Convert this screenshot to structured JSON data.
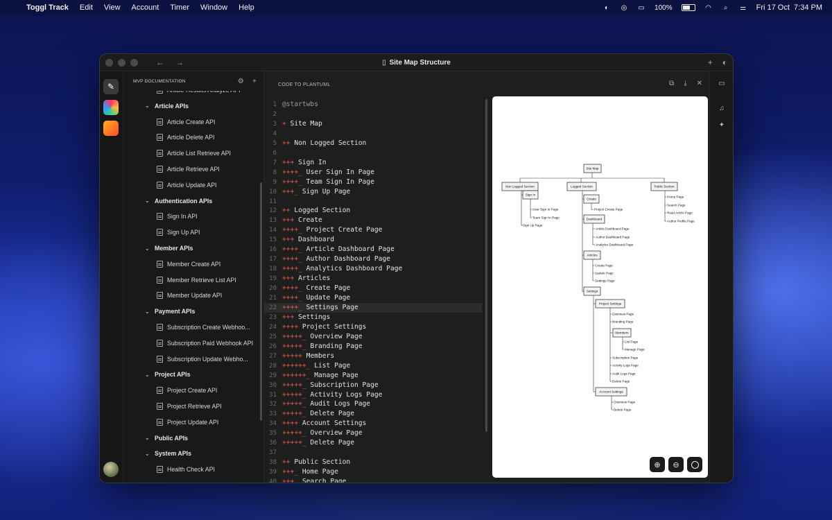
{
  "menubar": {
    "app_name": "Toggl Track",
    "items": [
      "Edit",
      "View",
      "Account",
      "Timer",
      "Window",
      "Help"
    ],
    "battery": "100%",
    "datetime": "Fri 17 Oct  7:34 PM"
  },
  "window": {
    "title": "Site Map Structure"
  },
  "sidebar": {
    "header": "MVP DOCUMENTATION",
    "rows": [
      {
        "kind": "item",
        "label": "Article Results Analyze API"
      },
      {
        "kind": "group",
        "label": "Article APIs"
      },
      {
        "kind": "item",
        "label": "Article Create API"
      },
      {
        "kind": "item",
        "label": "Article Delete API"
      },
      {
        "kind": "item",
        "label": "Article List Retrieve API"
      },
      {
        "kind": "item",
        "label": "Article Retrieve API"
      },
      {
        "kind": "item",
        "label": "Article Update API"
      },
      {
        "kind": "group",
        "label": "Authentication APIs"
      },
      {
        "kind": "item",
        "label": "Sign In API"
      },
      {
        "kind": "item",
        "label": "Sign Up API"
      },
      {
        "kind": "group",
        "label": "Member APIs"
      },
      {
        "kind": "item",
        "label": "Member Create API"
      },
      {
        "kind": "item",
        "label": "Member Retrieve List API"
      },
      {
        "kind": "item",
        "label": "Member Update API"
      },
      {
        "kind": "group",
        "label": "Payment APIs"
      },
      {
        "kind": "item",
        "label": "Subscription Create Webhoo..."
      },
      {
        "kind": "item",
        "label": "Subscription Paid Webhook API"
      },
      {
        "kind": "item",
        "label": "Subscription Update Webho..."
      },
      {
        "kind": "group",
        "label": "Project APIs"
      },
      {
        "kind": "item",
        "label": "Project Create API"
      },
      {
        "kind": "item",
        "label": "Project Retrieve API"
      },
      {
        "kind": "item",
        "label": "Project Update API"
      },
      {
        "kind": "group",
        "label": "Public APIs"
      },
      {
        "kind": "group",
        "label": "System APIs"
      },
      {
        "kind": "item",
        "label": "Health Check API"
      }
    ]
  },
  "editor": {
    "header": "CODE TO PLANTUML",
    "highlighted_line": 22,
    "lines": [
      {
        "n": "1",
        "m": "",
        "t": "@startwbs",
        "dir": true
      },
      {
        "n": "2",
        "m": "",
        "t": ""
      },
      {
        "n": "3",
        "m": "+",
        "t": " Site Map"
      },
      {
        "n": "4",
        "m": "",
        "t": ""
      },
      {
        "n": "5",
        "m": "++",
        "t": " Non Logged Section"
      },
      {
        "n": "6",
        "m": "",
        "t": ""
      },
      {
        "n": "7",
        "m": "+++",
        "t": " Sign In"
      },
      {
        "n": "8",
        "m": "++++_",
        "t": " User Sign In Page"
      },
      {
        "n": "9",
        "m": "++++_",
        "t": " Team Sign In Page"
      },
      {
        "n": "10",
        "m": "+++_",
        "t": " Sign Up Page"
      },
      {
        "n": "11",
        "m": "",
        "t": ""
      },
      {
        "n": "12",
        "m": "++",
        "t": " Logged Section"
      },
      {
        "n": "13",
        "m": "+++",
        "t": " Create"
      },
      {
        "n": "14",
        "m": "++++_",
        "t": " Project Create Page"
      },
      {
        "n": "15",
        "m": "+++",
        "t": " Dashboard"
      },
      {
        "n": "16",
        "m": "++++_",
        "t": " Article Dashboard Page"
      },
      {
        "n": "17",
        "m": "++++_",
        "t": " Author Dashboard Page"
      },
      {
        "n": "18",
        "m": "++++_",
        "t": " Analytics Dashboard Page"
      },
      {
        "n": "19",
        "m": "+++",
        "t": " Articles"
      },
      {
        "n": "20",
        "m": "++++_",
        "t": " Create Page"
      },
      {
        "n": "21",
        "m": "++++_",
        "t": " Update Page"
      },
      {
        "n": "22",
        "m": "++++_",
        "t": " Settings Page"
      },
      {
        "n": "23",
        "m": "+++",
        "t": " Settings"
      },
      {
        "n": "24",
        "m": "++++",
        "t": " Project Settings"
      },
      {
        "n": "25",
        "m": "+++++_",
        "t": " Overview Page"
      },
      {
        "n": "26",
        "m": "+++++_",
        "t": " Branding Page"
      },
      {
        "n": "27",
        "m": "+++++",
        "t": " Members"
      },
      {
        "n": "28",
        "m": "++++++_",
        "t": " List Page"
      },
      {
        "n": "29",
        "m": "++++++_",
        "t": " Manage Page"
      },
      {
        "n": "30",
        "m": "+++++_",
        "t": " Subscription Page"
      },
      {
        "n": "31",
        "m": "+++++_",
        "t": " Activity Logs Page"
      },
      {
        "n": "32",
        "m": "+++++_",
        "t": " Audit Logs Page"
      },
      {
        "n": "33",
        "m": "+++++_",
        "t": " Delete Page"
      },
      {
        "n": "34",
        "m": "++++",
        "t": " Account Settings"
      },
      {
        "n": "35",
        "m": "+++++_",
        "t": " Overview Page"
      },
      {
        "n": "36",
        "m": "+++++_",
        "t": " Delete Page"
      },
      {
        "n": "37",
        "m": "",
        "t": ""
      },
      {
        "n": "38",
        "m": "++",
        "t": " Public Section"
      },
      {
        "n": "39",
        "m": "+++_",
        "t": " Home Page"
      },
      {
        "n": "40",
        "m": "+++_",
        "t": " Search Page"
      }
    ]
  },
  "diagram": {
    "root": "Site Map",
    "sections": [
      "Non Logged Section",
      "Logged Section",
      "Public Section"
    ],
    "non_logged": {
      "sign_in": "Sign In",
      "sign_in_children": [
        "User Sign In Page",
        "Team Sign In Page"
      ],
      "sign_up": "Sign Up Page"
    },
    "logged": {
      "create": "Create",
      "create_children": [
        "Project Create Page"
      ],
      "dashboard": "Dashboard",
      "dashboard_children": [
        "Article Dashboard Page",
        "Author Dashboard Page",
        "Analytics Dashboard Page"
      ],
      "articles": "Articles",
      "articles_children": [
        "Create Page",
        "Update Page",
        "Settings Page"
      ],
      "settings": "Settings",
      "project_settings": "Project Settings",
      "ps_children_a": [
        "Overview Page",
        "Branding Page"
      ],
      "members": "Members",
      "members_children": [
        "List Page",
        "Manage Page"
      ],
      "ps_children_b": [
        "Subscription Page",
        "Activity Logs Page",
        "Audit Logs Page",
        "Delete Page"
      ],
      "account_settings": "Account Settings",
      "account_children": [
        "Overview Page",
        "Delete Page"
      ]
    },
    "public": [
      "Home Page",
      "Search Page",
      "Read Article Page",
      "Author Profile Page"
    ]
  },
  "icons": {
    "apple": "apple-logo-icon",
    "back": "arrow-left-icon",
    "forward": "arrow-right-icon",
    "add": "plus-icon",
    "theme": "half-circle-icon",
    "zoom_in": "zoom-in-icon",
    "zoom_out": "zoom-out-icon",
    "reset": "reset-zoom-icon"
  }
}
